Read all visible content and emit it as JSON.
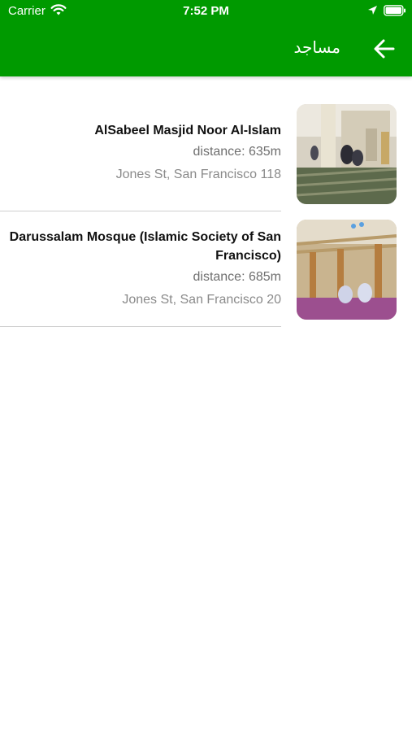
{
  "status_bar": {
    "carrier": "Carrier",
    "time": "7:52 PM"
  },
  "header": {
    "title": "مساجد",
    "back_icon": "arrow-left-icon",
    "color": "#009a00"
  },
  "mosques": [
    {
      "name": "AlSabeel Masjid Noor Al-Islam",
      "distance": "distance: 635m",
      "address": "Jones St, San Francisco 118"
    },
    {
      "name": "Darussalam Mosque (Islamic Society of San Francisco)",
      "distance": "distance: 685m",
      "address": "Jones St, San Francisco 20"
    }
  ]
}
